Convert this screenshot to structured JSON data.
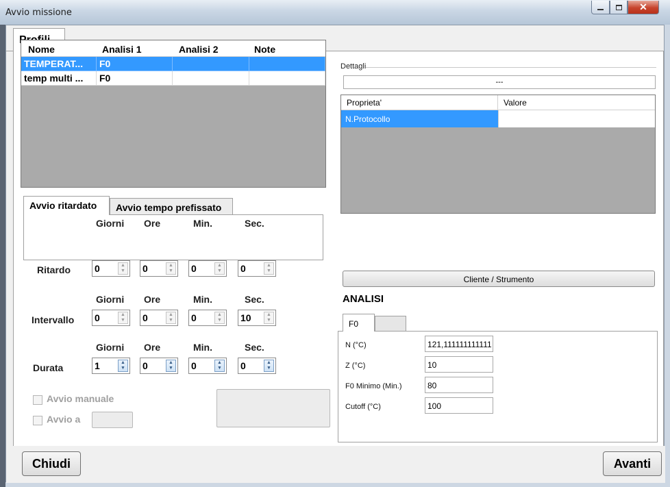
{
  "window": {
    "title": "Avvio missione",
    "close_glyph": "✕"
  },
  "tabs": {
    "profili": "Profili"
  },
  "profiles_grid": {
    "columns": [
      "Nome",
      "Analisi 1",
      "Analisi 2",
      "Note"
    ],
    "rows": [
      {
        "nome": "TEMPERAT...",
        "analisi1": "F0",
        "analisi2": "",
        "note": "",
        "selected": true
      },
      {
        "nome": "temp multi ...",
        "analisi1": "F0",
        "analisi2": "",
        "note": "",
        "selected": false
      }
    ]
  },
  "delay_tabs": {
    "tab1": "Avvio ritardato",
    "tab2": "Avvio tempo prefissato"
  },
  "time_headers": {
    "giorni": "Giorni",
    "ore": "Ore",
    "min": "Min.",
    "sec": "Sec."
  },
  "ritardo": {
    "label": "Ritardo",
    "giorni": "0",
    "ore": "0",
    "min": "0",
    "sec": "0"
  },
  "intervallo": {
    "label": "Intervallo",
    "giorni": "0",
    "ore": "0",
    "min": "0",
    "sec": "10"
  },
  "durata": {
    "label": "Durata",
    "giorni": "1",
    "ore": "0",
    "min": "0",
    "sec": "0"
  },
  "options": {
    "avvio_manuale": "Avvio manuale",
    "avvio_a": "Avvio a"
  },
  "details": {
    "legend": "Dettagli",
    "value": "---",
    "columns": [
      "Proprieta'",
      "Valore"
    ],
    "rows": [
      {
        "name": "N.Protocollo",
        "value": ""
      }
    ]
  },
  "cliente_button": "Cliente / Strumento",
  "analisi": {
    "title": "ANALISI",
    "tab": "F0",
    "fields": [
      {
        "label": "N (°C)",
        "value": "121,111111111111"
      },
      {
        "label": "Z (°C)",
        "value": "10"
      },
      {
        "label": "F0 Minimo (Min.)",
        "value": "80"
      },
      {
        "label": "Cutoff (°C)",
        "value": "100"
      }
    ]
  },
  "buttons": {
    "close": "Chiudi",
    "next": "Avanti"
  },
  "colors": {
    "selection": "#3399ff",
    "grid_background": "#aaaaaa",
    "close_button": "#c7442d"
  }
}
